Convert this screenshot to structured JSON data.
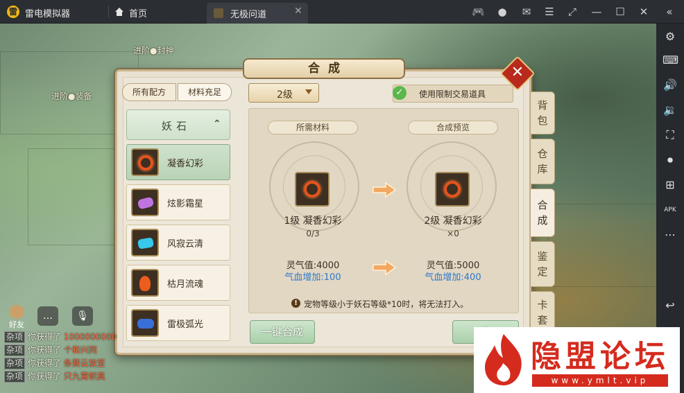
{
  "titlebar": {
    "app_title": "雷电模拟器",
    "home_label": "首页",
    "tab_label": "无极问道",
    "icons": [
      "gamepad-icon",
      "user-icon",
      "mail-icon",
      "menu-icon",
      "fullscreen-icon",
      "minimize-icon",
      "maximize-icon",
      "close-icon",
      "collapse-icon"
    ]
  },
  "rightbar": {
    "icons": [
      "settings-icon",
      "keyboard-icon",
      "volume-up-icon",
      "volume-down-icon",
      "screenshot-icon",
      "record-icon",
      "add-app-icon",
      "apk-icon",
      "more-icon",
      "back-icon",
      "home-icon",
      "recent-icon"
    ]
  },
  "world": {
    "labels": [
      "进阶●封神",
      "进阶●装备"
    ]
  },
  "dialog": {
    "title": "合成",
    "close_label": "✕",
    "recipe_tabs": {
      "all": "所有配方",
      "enough": "材料充足"
    },
    "category": {
      "label": "妖石",
      "chevron": "⌃"
    },
    "items": [
      {
        "label": "凝香幻彩",
        "selected": true,
        "gem": "red-ring"
      },
      {
        "label": "炫影霜星",
        "selected": false,
        "gem": "purple"
      },
      {
        "label": "风寂云清",
        "selected": false,
        "gem": "cyan"
      },
      {
        "label": "枯月流魂",
        "selected": false,
        "gem": "orange"
      },
      {
        "label": "雷极弧光",
        "selected": false,
        "gem": "blue"
      }
    ],
    "level_select": "2级",
    "restrict_option": "使用限制交易道具",
    "restrict_checked": true,
    "materials_tag": "所需材料",
    "preview_tag": "合成预览",
    "material": {
      "name": "1级 凝香幻彩",
      "count": "0/3"
    },
    "result": {
      "name": "2级 凝香幻彩",
      "count": "×0"
    },
    "stats_left": {
      "line1": "灵气值:4000",
      "line2": "气血增加:100"
    },
    "stats_right": {
      "line1": "灵气值:5000",
      "line2": "气血增加:400"
    },
    "warning": "宠物等级小于妖石等级*10时，将无法打入。",
    "btn_one_key": "一键合成",
    "btn_synth": "合",
    "side_tabs": [
      {
        "label": "背包",
        "active": false
      },
      {
        "label": "仓库",
        "active": false
      },
      {
        "label": "合成",
        "active": true
      },
      {
        "label": "鉴定",
        "active": false
      },
      {
        "label": "卡套",
        "active": false
      }
    ]
  },
  "chat": {
    "friend_label": "好友",
    "lines": [
      {
        "tag": "杂项",
        "text": "你获得了",
        "extra": "1000000000"
      },
      {
        "tag": "杂项",
        "text": "你获得了",
        "extra": "个和兴同"
      },
      {
        "tag": "杂项",
        "text": "你获得了",
        "extra": "条赛云放至"
      },
      {
        "tag": "杂项",
        "text": "你获得了",
        "extra": "只九霄帜真"
      }
    ]
  },
  "watermark": {
    "title": "隐盟论坛",
    "url": "www.ymlt.vip"
  },
  "colors": {
    "accent_red": "#d52b1e",
    "stat_blue": "#2f78c8",
    "panel_bg": "#e9e1d2",
    "button_green": "#a9cfa9"
  }
}
